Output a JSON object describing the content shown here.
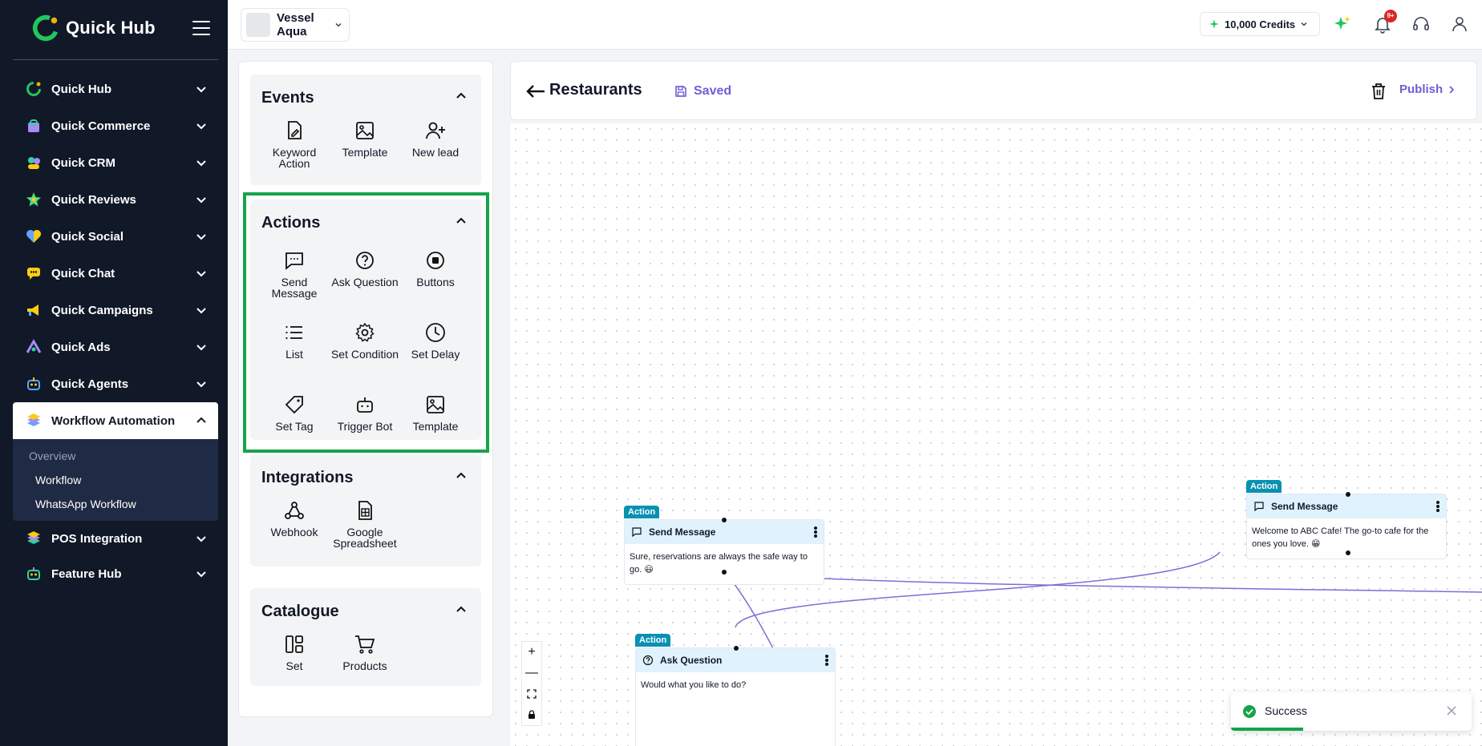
{
  "brand": {
    "name": "Quick Hub"
  },
  "sidebar": {
    "items": [
      {
        "label": "Quick Hub",
        "icon": "quick-hub-icon"
      },
      {
        "label": "Quick Commerce",
        "icon": "shopping-bag-icon"
      },
      {
        "label": "Quick CRM",
        "icon": "crm-icon"
      },
      {
        "label": "Quick Reviews",
        "icon": "star-icon"
      },
      {
        "label": "Quick Social",
        "icon": "heart-icon"
      },
      {
        "label": "Quick Chat",
        "icon": "chat-icon"
      },
      {
        "label": "Quick Campaigns",
        "icon": "megaphone-icon"
      },
      {
        "label": "Quick Ads",
        "icon": "ads-icon"
      },
      {
        "label": "Quick Agents",
        "icon": "robot-icon"
      },
      {
        "label": "Workflow Automation",
        "icon": "workflow-icon",
        "active": true
      },
      {
        "label": "POS Integration",
        "icon": "pos-icon"
      },
      {
        "label": "Feature Hub",
        "icon": "feature-icon"
      }
    ],
    "workflow_sub": {
      "heading": "Overview",
      "items": [
        "Workflow",
        "WhatsApp Workflow"
      ]
    }
  },
  "topbar": {
    "account_name": "Vessel Aqua",
    "credits": "10,000 Credits",
    "notification_badge": "9+"
  },
  "palette": {
    "events": {
      "title": "Events",
      "items": [
        "Keyword Action",
        "Template",
        "New lead"
      ]
    },
    "actions": {
      "title": "Actions",
      "items": [
        "Send Message",
        "Ask Question",
        "Buttons",
        "List",
        "Set Condition",
        "Set Delay",
        "Set Tag",
        "Trigger Bot",
        "Template"
      ]
    },
    "integrations": {
      "title": "Integrations",
      "items": [
        "Webhook",
        "Google Spreadsheet"
      ]
    },
    "catalogue": {
      "title": "Catalogue",
      "items": [
        "Set",
        "Products"
      ]
    }
  },
  "workflow": {
    "title": "Restaurants",
    "saved_label": "Saved",
    "publish_label": "Publish"
  },
  "nodes": [
    {
      "tag": "Action",
      "title": "Send Message",
      "body": "Sure, reservations are always the safe way to go. 😃"
    },
    {
      "tag": "Action",
      "title": "Ask Question",
      "body": "Would what you like to do?"
    },
    {
      "tag": "Action",
      "title": "Send Message",
      "body": "Welcome to ABC Cafe! The go-to cafe for the ones you love. 😁"
    }
  ],
  "zoom_controls": {
    "zoom_in": "+",
    "zoom_out": "—"
  },
  "toast": {
    "message": "Success"
  },
  "colors": {
    "accent": "#6d5fd5",
    "success": "#16a34a",
    "sidebar_bg": "#111827",
    "action_tag": "#0891b2"
  }
}
